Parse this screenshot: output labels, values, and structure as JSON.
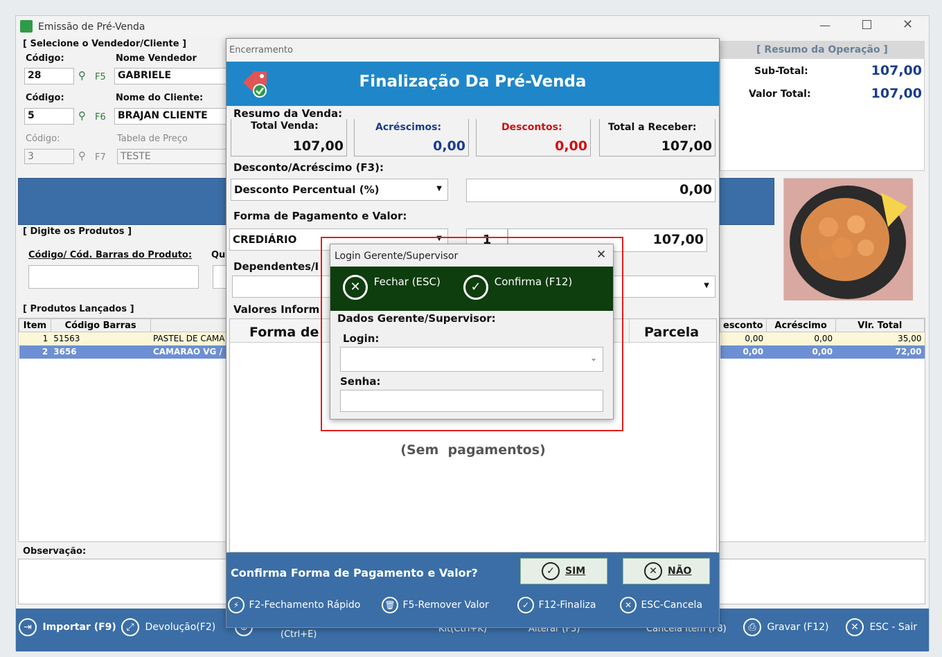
{
  "main": {
    "title": "Emissão de Pré-Venda",
    "vendor_section": "[ Selecione o Vendedor/Cliente ]",
    "codigo_label": "Código:",
    "nome_vendedor_label": "Nome Vendedor",
    "vendedor_codigo": "28",
    "vendedor_key": "F5",
    "vendedor_nome": "GABRIELE",
    "nome_cliente_label": "Nome do Cliente:",
    "cliente_codigo": "5",
    "cliente_key": "F6",
    "cliente_nome": "BRAJAN CLIENTE",
    "tabela_label": "Tabela de Preço",
    "tabela_codigo": "3",
    "tabela_key": "F7",
    "tabela_nome": "TESTE",
    "resumo_title": "[ Resumo da Operação ]",
    "subtotal_label": "Sub-Total:",
    "subtotal_value": "107,00",
    "valortotal_label": "Valor Total:",
    "valortotal_value": "107,00",
    "digite_produtos": "[ Digite os Produtos ]",
    "codigo_barras_label": "Código/ Cód. Barras do Produto:",
    "qtd_label": "Qu",
    "produtos_lancados": "[ Produtos Lançados ]",
    "grid_headers": [
      "Item",
      "Código Barras",
      "",
      "esconto",
      "Acréscimo",
      "Vlr. Total"
    ],
    "rows": [
      {
        "item": "1",
        "codigo": "51563",
        "desc": "PASTEL DE CAMA",
        "desconto": "0,00",
        "acrescimo": "0,00",
        "total": "35,00"
      },
      {
        "item": "2",
        "codigo": "3656",
        "desc": "CAMARAO VG /",
        "desconto": "0,00",
        "acrescimo": "0,00",
        "total": "72,00"
      }
    ],
    "observacao_label": "Observação:",
    "bottom": {
      "importar": "Importar (F9)",
      "devolucao": "Devolução(F2)",
      "ctrl_e": "(Ctrl+E)",
      "kit": "Kit(Ctrl+K)",
      "alterar": "Alterar (F3)",
      "cancela_item": "Cancela Item (F8)",
      "gravar": "Gravar (F12)",
      "sair": "ESC - Sair"
    }
  },
  "encerramento": {
    "title": "Encerramento",
    "header": "Finalização Da Pré-Venda",
    "resumo_label": "Resumo da Venda:",
    "total_venda_label": "Total Venda:",
    "total_venda": "107,00",
    "acrescimos_label": "Acréscimos:",
    "acrescimos": "0,00",
    "descontos_label": "Descontos:",
    "descontos": "0,00",
    "total_receber_label": "Total a Receber:",
    "total_receber": "107,00",
    "desconto_acrescimo_label": "Desconto/Acréscimo (F3):",
    "desconto_tipo": "Desconto Percentual (%)",
    "desconto_valor": "0,00",
    "forma_label": "Forma de Pagamento e Valor:",
    "forma": "CREDIÁRIO",
    "parcelas": "1",
    "forma_valor": "107,00",
    "dependentes_label": "Dependentes/I",
    "valores_label": "Valores Inform",
    "col_forma": "Forma de",
    "col_parcela": "Parcela",
    "sem_pagamentos": "(Sem  pagamentos)",
    "confirma_question": "Confirma Forma de Pagamento e Valor?",
    "sim": "SIM",
    "nao": "NÃO",
    "f2": "F2-Fechamento Rápido",
    "f5": "F5-Remover Valor",
    "f12": "F12-Finaliza",
    "esc": "ESC-Cancela"
  },
  "login": {
    "title": "Login Gerente/Supervisor",
    "fechar": "Fechar (ESC)",
    "confirma": "Confirma (F12)",
    "section": "Dados Gerente/Supervisor:",
    "login_label": "Login:",
    "login_value": "",
    "senha_label": "Senha:",
    "senha_value": ""
  },
  "colors": {
    "blue_header": "#1f87c9",
    "bottom_bar": "#3b6ea6",
    "dark_green": "#0e3d0e",
    "highlight_red": "#e81c1c",
    "selected_row": "#6d8fd4"
  }
}
